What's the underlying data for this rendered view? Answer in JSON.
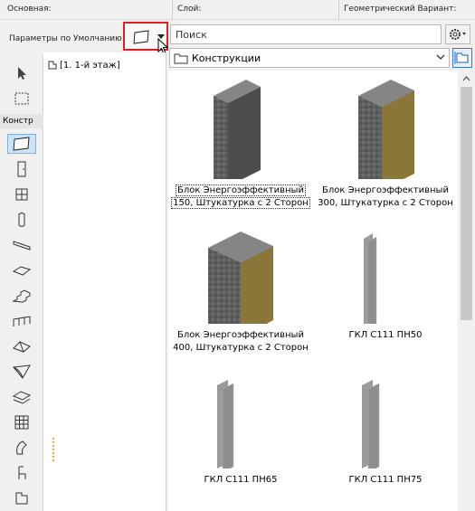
{
  "header": {
    "basic_label": "Основная:",
    "layer_label": "Слой:",
    "geometry_label": "Геометрический Вариант:"
  },
  "toolbar": {
    "defaults_label": "Параметры по Умолчанию",
    "search_placeholder": "Поиск"
  },
  "toolbox": {
    "section_label": "Констр",
    "tools": [
      "arrow-select-icon",
      "marquee-icon",
      "wall-icon",
      "door-icon",
      "window-icon",
      "column-icon",
      "beam-icon",
      "slab-icon",
      "stair-icon",
      "railing-icon",
      "roof-icon",
      "shell-icon",
      "mesh-icon",
      "curtain-wall-icon",
      "morph-icon",
      "object-icon",
      "zone-icon"
    ]
  },
  "tree": {
    "story": "[1. 1-й этаж]"
  },
  "folder": {
    "name": "Конструкции"
  },
  "gallery": {
    "items": [
      {
        "line1": "Блок Энергоэффективный",
        "line2": "150, Штукатурка с 2 Сторон",
        "selected": true
      },
      {
        "line1": "Блок Энергоэффективный",
        "line2": "300, Штукатурка с 2 Сторон",
        "selected": false
      },
      {
        "line1": "Блок Энергоэффективный",
        "line2": "400, Штукатурка с 2 Сторон",
        "selected": false
      },
      {
        "line1": "ГКЛ С111 ПН50",
        "line2": "",
        "selected": false
      },
      {
        "line1": "ГКЛ С111 ПН65",
        "line2": "",
        "selected": false
      },
      {
        "line1": "ГКЛ С111 ПН75",
        "line2": "",
        "selected": false
      }
    ]
  },
  "colors": {
    "highlight_border": "#e02020",
    "selection_blue": "#cde3f7",
    "brick_top": "#7a7a7a",
    "brick_front": "#5c5c5c",
    "plaster_side": "#8a7638",
    "gypsum": "#8e8e8e"
  }
}
